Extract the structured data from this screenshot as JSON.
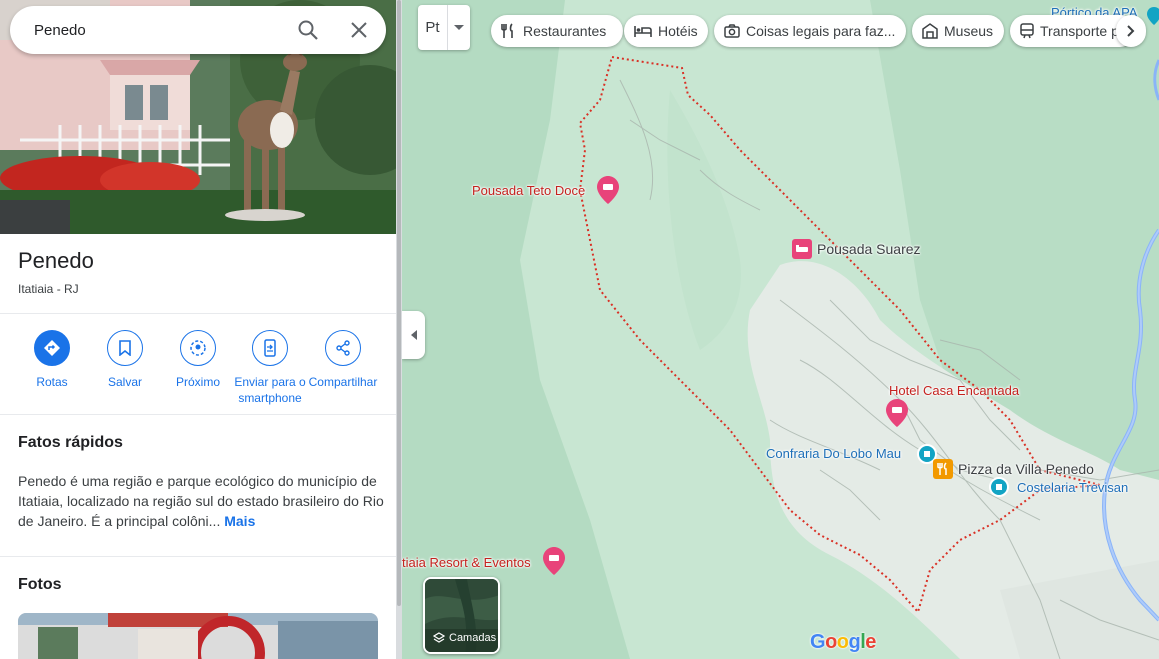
{
  "search": {
    "value": "Penedo"
  },
  "place": {
    "title": "Penedo",
    "subtitle": "Itatiaia - RJ"
  },
  "actions": [
    {
      "label": "Rotas"
    },
    {
      "label": "Salvar"
    },
    {
      "label": "Próximo"
    },
    {
      "label": "Enviar para o smartphone"
    },
    {
      "label": "Compartilhar"
    }
  ],
  "facts": {
    "heading": "Fatos rápidos",
    "text": "Penedo é uma região e parque ecológico do município de Itatiaia, localizado na região sul do estado brasileiro do Rio de Janeiro. É a principal colôni...",
    "more": "Mais"
  },
  "photos": {
    "heading": "Fotos"
  },
  "map": {
    "transit_label": "Pt",
    "chips": [
      {
        "label": "Restaurantes",
        "icon": "fork-knife-icon"
      },
      {
        "label": "Hotéis",
        "icon": "bed-icon"
      },
      {
        "label": "Coisas legais para faz...",
        "icon": "camera-icon"
      },
      {
        "label": "Museus",
        "icon": "museum-icon"
      },
      {
        "label": "Transporte p",
        "icon": "train-icon"
      }
    ],
    "places": [
      {
        "name": "Pórtico da APA",
        "kind": "attraction"
      },
      {
        "name": "Pousada Teto Doce",
        "kind": "hotel"
      },
      {
        "name": "Pousada Suarez",
        "kind": "hotel"
      },
      {
        "name": "Hotel Casa Encantada",
        "kind": "hotel"
      },
      {
        "name": "Confraria Do Lobo Mau",
        "kind": "shop"
      },
      {
        "name": "Pizza da Villa Penedo",
        "kind": "restaurant"
      },
      {
        "name": "Costelaria Trevisan",
        "kind": "shop"
      },
      {
        "name": "tiaia Resort & Eventos",
        "kind": "hotel"
      }
    ],
    "layers_label": "Camadas",
    "logo": "Google"
  },
  "colors": {
    "accent": "#1a73e8",
    "map_green": "#c9e7d3",
    "hotel_pin": "#e8437a",
    "restaurant_pin": "#f29900",
    "shop_pin": "#12a4c4"
  }
}
